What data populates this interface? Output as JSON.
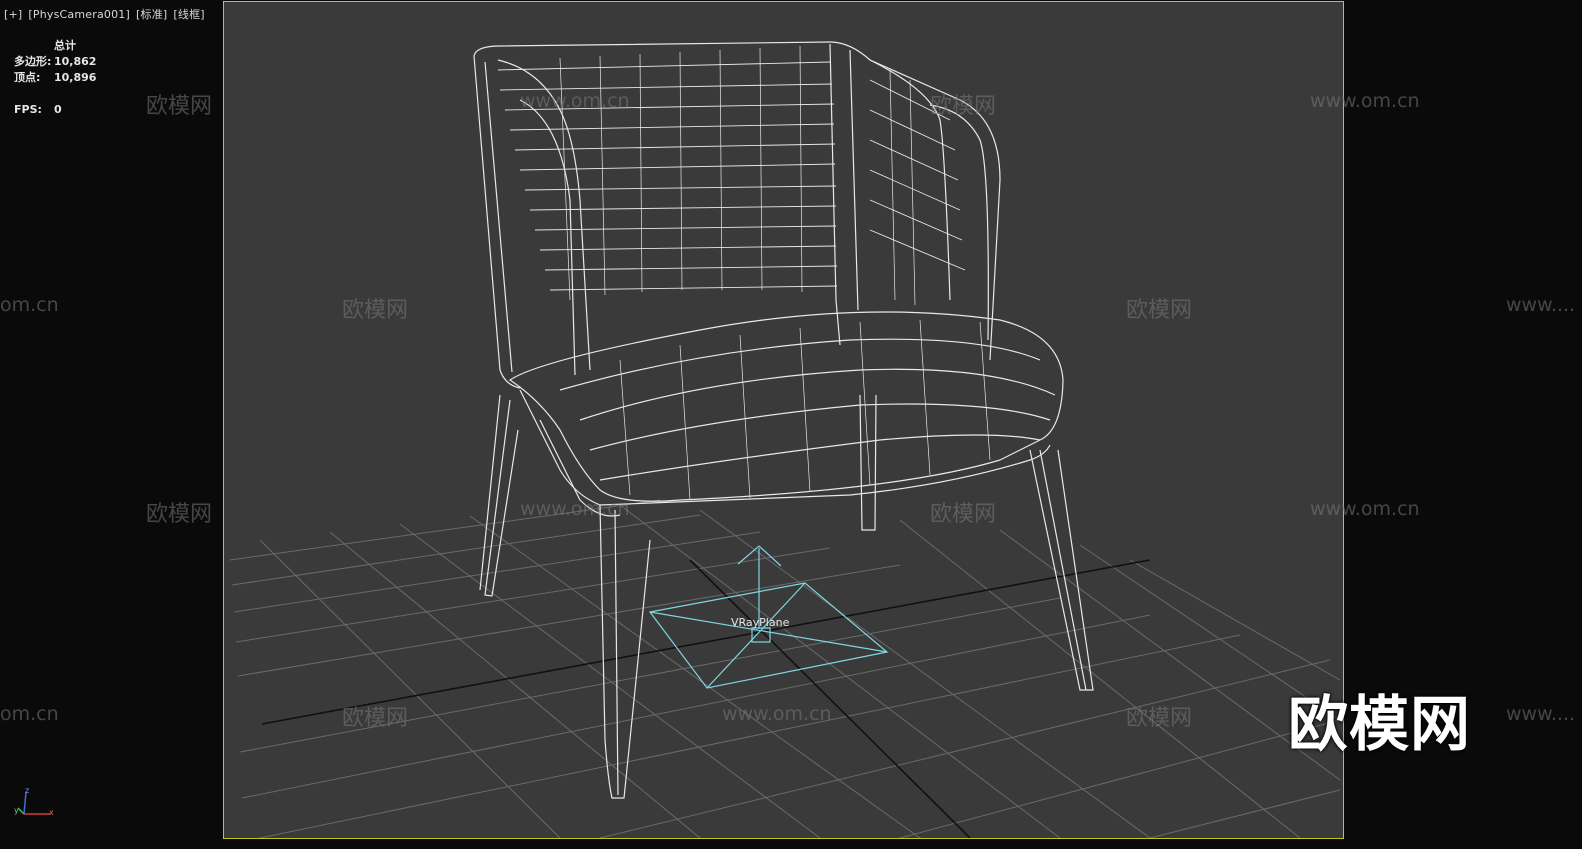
{
  "viewport": {
    "labels": [
      "[+]",
      "[PhysCamera001]",
      "[标准]",
      "[线框]"
    ]
  },
  "stats": {
    "header": "总计",
    "polygons_label": "多边形:",
    "polygons_value": "10,862",
    "vertices_label": "顶点:",
    "vertices_value": "10,896",
    "fps_label": "FPS:",
    "fps_value": "0"
  },
  "scene": {
    "object_label": "VRayPlane",
    "gizmo_axes": {
      "z": "z",
      "x": "x",
      "y": "y"
    }
  },
  "watermark": {
    "brand": "欧模网",
    "url": "www.om.cn",
    "url_partial": "om.cn",
    "url_trunc": "www...."
  },
  "colors": {
    "viewport_bg": "#3a3a3a",
    "safe_frame": "#c9c21a",
    "wireframe": "#e8e8e8",
    "vray_plane": "#7fd6e0"
  }
}
